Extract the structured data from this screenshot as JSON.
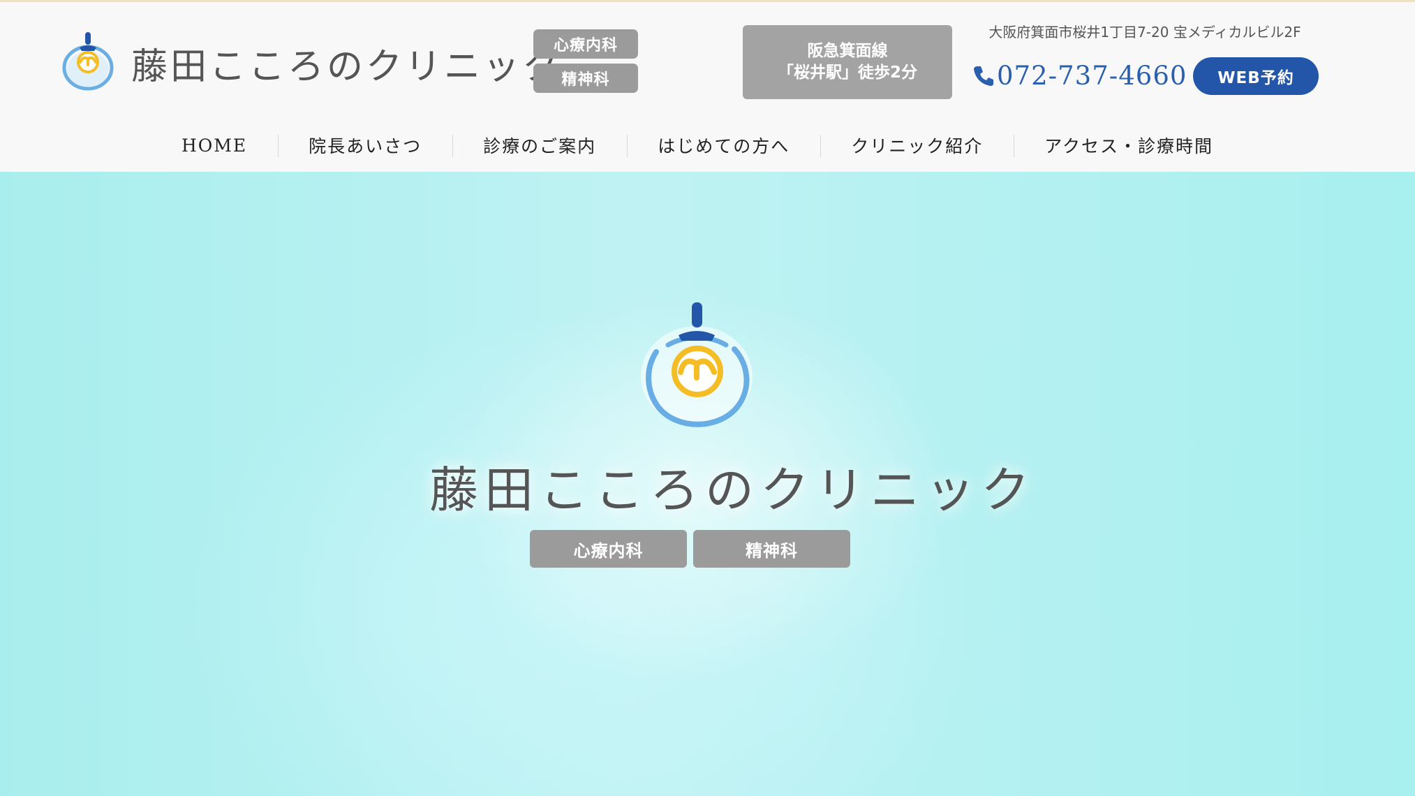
{
  "brand": {
    "name": "藤田こころのクリニック",
    "departments": [
      "心療内科",
      "精神科"
    ]
  },
  "header": {
    "station_line1": "阪急箕面線",
    "station_line2": "「桜井駅」徒歩2分",
    "address": "大阪府箕面市桜井1丁目7-20 宝メディカルビル2F",
    "phone": "072-737-4660",
    "reservation_button": "WEB予約"
  },
  "navigation": [
    {
      "label": "HOME"
    },
    {
      "label": "院長あいさつ"
    },
    {
      "label": "診療のご案内"
    },
    {
      "label": "はじめての方へ"
    },
    {
      "label": "クリニック紹介"
    },
    {
      "label": "アクセス・診療時間"
    }
  ],
  "hero": {
    "title": "藤田こころのクリニック",
    "departments": [
      "心療内科",
      "精神科"
    ]
  },
  "colors": {
    "accent_blue": "#2356a8",
    "phone_blue": "#2a5fae",
    "badge_gray": "#9b9b9b",
    "hero_aqua": "#a9eeee",
    "logo_yellow": "#f4bd25",
    "logo_light_blue": "#6aaee2"
  },
  "icons": {
    "logo": "clinic-lamp-logo-icon",
    "phone": "phone-icon"
  }
}
